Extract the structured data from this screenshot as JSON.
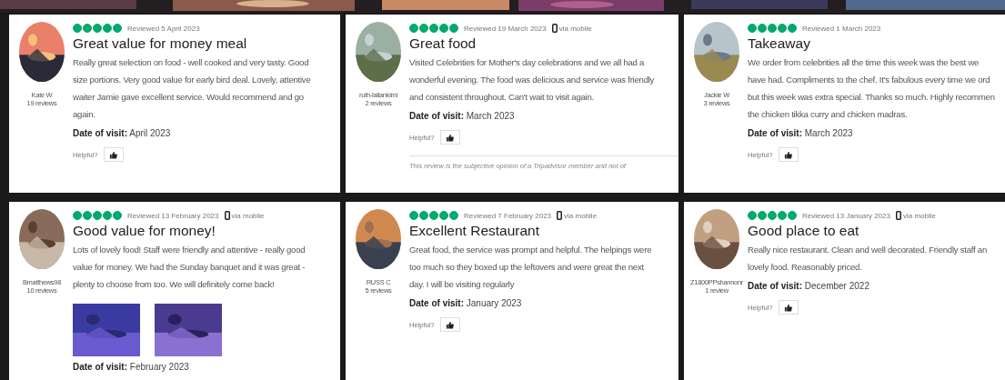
{
  "reviews": [
    {
      "author": "Kate W",
      "review_count": "19 reviews",
      "stars": 5,
      "reviewed": "Reviewed 5 April 2023",
      "title": "Great value for money meal",
      "body": "Really great selection on food - well cooked and very tasty. Good\nsize portions. Very good value for early bird deal. Lovely, attentive\nwaiter Jamie gave excellent service. Would recommend and go\nagain.",
      "visit": "**Date of visit:** April 2023",
      "helpful": "Helpful?"
    },
    {
      "author": "ruth-lallankimi",
      "review_count": "2 reviews",
      "stars": 5,
      "reviewed": "Reviewed 19 March 2023",
      "device": "via mobile",
      "title": "Great food",
      "body": "Visited Celebrities for Mother's day celebrations and we all had a\nwonderful evening. The food was delicious and service was friendly\nand consistent throughout. Can't wait to visit again.",
      "visit": "**Date of visit:** March 2023",
      "helpful": "Helpful?",
      "disclaimer": "This review is the subjective opinion of a Tripadvisor member and not of"
    },
    {
      "author": "Jackie W",
      "review_count": "3 reviews",
      "stars": 5,
      "reviewed": "Reviewed 1 March 2023",
      "title": "Takeaway",
      "body": "We order from celebrities all the time this week was the best we\nhave had. Compliments to the chef. It's fabulous every time we ord\nbut this week was extra special. Thanks so much. Highly recommen\nthe chicken tikka curry and chicken madras.",
      "visit": "**Date of visit:** March 2023",
      "helpful": "Helpful?"
    },
    {
      "author": "Bmatthews98",
      "review_count": "10 reviews",
      "stars": 5,
      "reviewed": "Reviewed 13 February 2023",
      "device": "via mobile",
      "title": "Good value for money!",
      "body": "Lots of lovely food! Staff were friendly and attentive - really good\nvalue for money. We had the Sunday banquet and it was great -\nplenty to choose from too. We will definitely come back!",
      "photos": [
        {
          "kind": "picture"
        },
        {
          "kind": "picture"
        }
      ],
      "visit": "**Date of visit:** February 2023"
    },
    {
      "author": "RUSS C",
      "review_count": "5 reviews",
      "stars": 5,
      "reviewed": "Reviewed 7 February 2023",
      "device": "via mobile",
      "title": "Excellent Restaurant",
      "body": "Great food, the service was prompt and helpful. The helpings were\ntoo much so they boxed up the leftovers and were great the next\nday. I will be visiting regularly",
      "visit": "**Date of visit:** January 2023",
      "helpful": "Helpful?"
    },
    {
      "author": "Z1800PPshannonr",
      "review_count": "1 review",
      "stars": 5,
      "reviewed": "Reviewed 13 January 2023",
      "device": "via mobile",
      "title": "Good place to eat",
      "body": "Really nice restaurant. Clean and well decorated. Friendly staff an\nlovely food. Reasonably priced.",
      "visit": "**Date of visit:** December 2022",
      "helpful": "Helpful?"
    }
  ]
}
